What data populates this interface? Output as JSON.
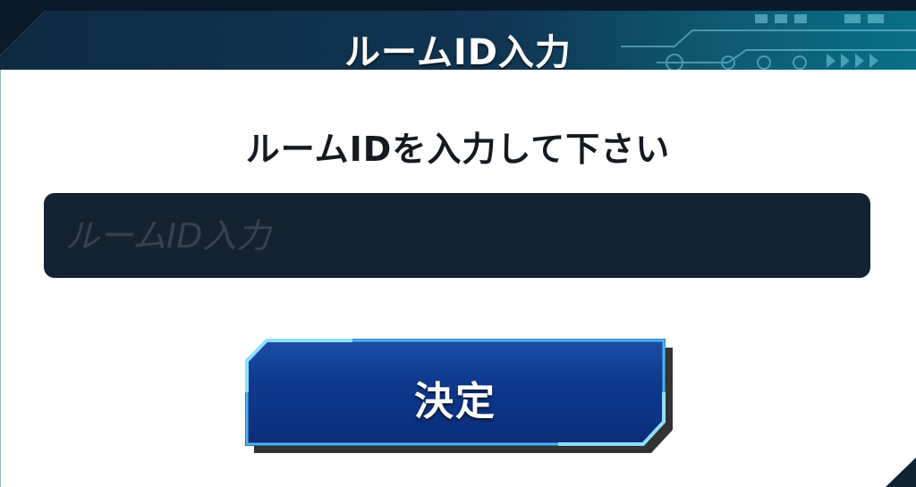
{
  "dialog": {
    "title": "ルームID入力",
    "prompt": "ルームIDを入力して下さい",
    "input": {
      "value": "",
      "placeholder": "ルームID入力"
    },
    "confirm_label": "決定"
  },
  "colors": {
    "header_bg": "#103552",
    "input_bg": "#132333",
    "button_bg": "#0e3a8e",
    "button_border": "#4fb3f0"
  }
}
